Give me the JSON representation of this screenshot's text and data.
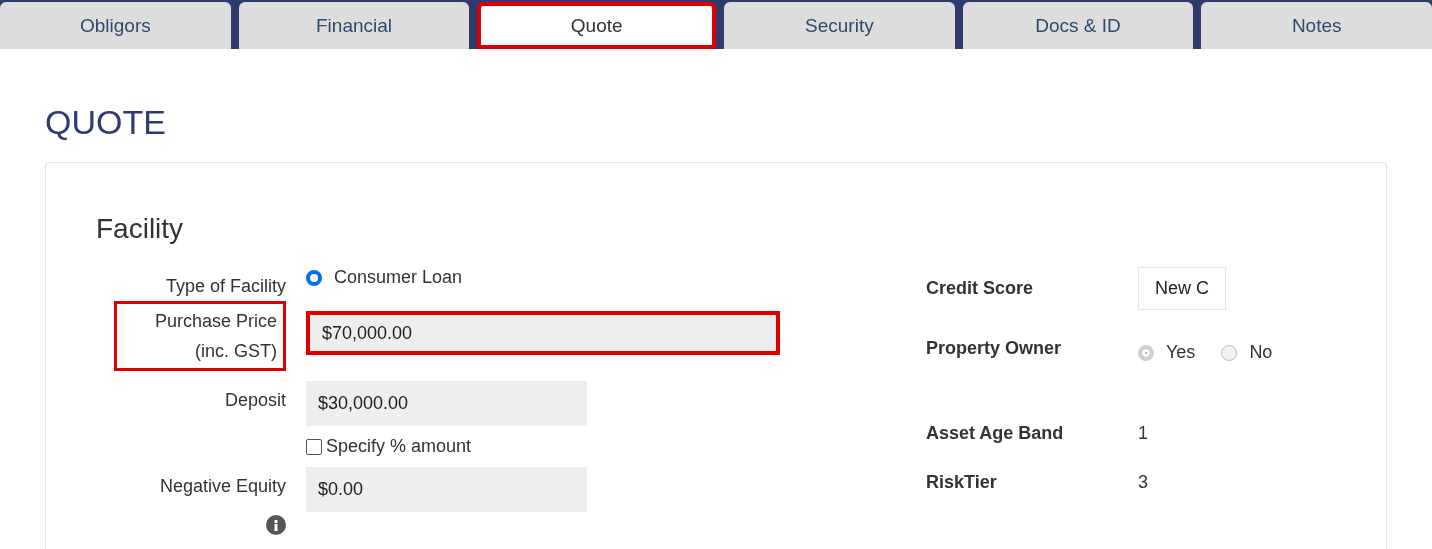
{
  "tabs": [
    {
      "label": "Obligors",
      "selected": false,
      "highlighted": false
    },
    {
      "label": "Financial",
      "selected": false,
      "highlighted": false
    },
    {
      "label": "Quote",
      "selected": true,
      "highlighted": true
    },
    {
      "label": "Security",
      "selected": false,
      "highlighted": false
    },
    {
      "label": "Docs & ID",
      "selected": false,
      "highlighted": false
    },
    {
      "label": "Notes",
      "selected": false,
      "highlighted": false
    }
  ],
  "heading": "QUOTE",
  "section": "Facility",
  "left_fields": [
    {
      "kind": "radio",
      "label": "Type of Facility",
      "option": "Consumer Loan",
      "selected": true
    },
    {
      "kind": "input",
      "label": "Purchase Price (inc. GST)",
      "value": "$70,000.00",
      "wide": true,
      "highlighted": true
    },
    {
      "kind": "input",
      "label": "Deposit",
      "value": "$30,000.00",
      "wide": false,
      "highlighted": false,
      "checkbox": {
        "label": "Specify % amount",
        "checked": false
      }
    },
    {
      "kind": "input",
      "label": "Negative Equity",
      "value": "$0.00",
      "wide": false,
      "highlighted": false,
      "info": true
    }
  ],
  "right_fields": [
    {
      "kind": "box",
      "label": "Credit Score",
      "value": "New C"
    },
    {
      "kind": "radios",
      "label": "Property Owner",
      "disabled": true,
      "options": [
        {
          "label": "Yes",
          "selected": true
        },
        {
          "label": "No",
          "selected": false
        }
      ]
    },
    {
      "kind": "text",
      "label": "Asset Age Band",
      "value": "1"
    },
    {
      "kind": "text",
      "label": "RiskTier",
      "value": "3"
    }
  ]
}
